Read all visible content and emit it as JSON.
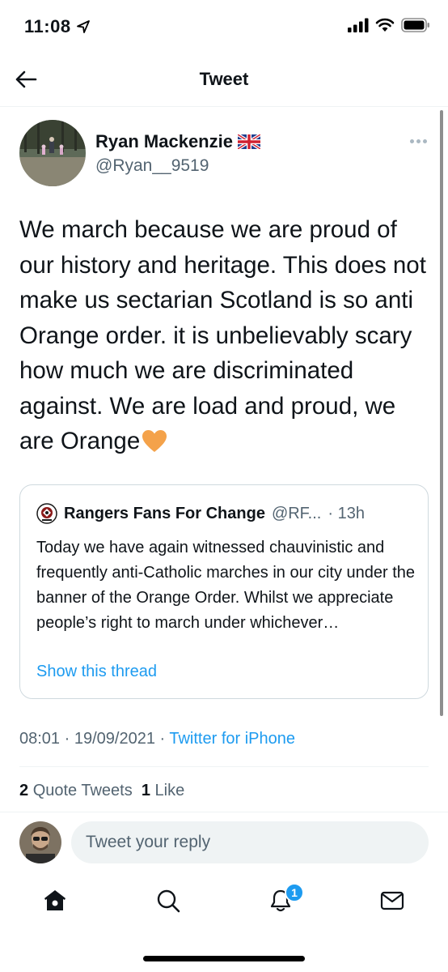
{
  "status_bar": {
    "time": "11:08",
    "icons": [
      "location-arrow-icon",
      "signal-icon",
      "wifi-icon",
      "battery-icon"
    ]
  },
  "header": {
    "back_icon": "back-arrow-icon",
    "title": "Tweet"
  },
  "author": {
    "name": "Ryan Mackenzie",
    "flag_icon": "uk-flag-icon",
    "handle": "@Ryan__9519",
    "more_icon": "more-icon"
  },
  "tweet": {
    "text": "We march because we are proud of our history and heritage. This does not make us sectarian Scotland is so anti Orange order. it is unbelievably scary how much we are discriminated against. We are load and proud, we are Orange",
    "emoji_icon": "orange-heart-icon"
  },
  "quoted_tweet": {
    "name": "Rangers Fans For Change",
    "handle": "@RF...",
    "time": "· 13h",
    "text": "Today we have again witnessed chauvinistic and frequently anti-Catholic marches in our city under the banner of the Orange Order. Whilst we appreciate people’s right to march under whichever…",
    "show_thread": "Show this thread"
  },
  "meta": {
    "time": "08:01",
    "date": "19/09/2021",
    "source": "Twitter for iPhone"
  },
  "stats": {
    "quote_count": "2",
    "quote_label": "Quote Tweets",
    "like_count": "1",
    "like_label": "Like"
  },
  "reply": {
    "placeholder": "Tweet your reply"
  },
  "tab_bar": {
    "tabs": [
      "home-icon",
      "search-icon",
      "notifications-icon",
      "messages-icon"
    ],
    "notification_badge": "1"
  },
  "colors": {
    "accent": "#1d9bf0",
    "text_primary": "#0f1419",
    "text_secondary": "#536471",
    "border": "#cfd9de",
    "heart": "#f4a24a"
  }
}
